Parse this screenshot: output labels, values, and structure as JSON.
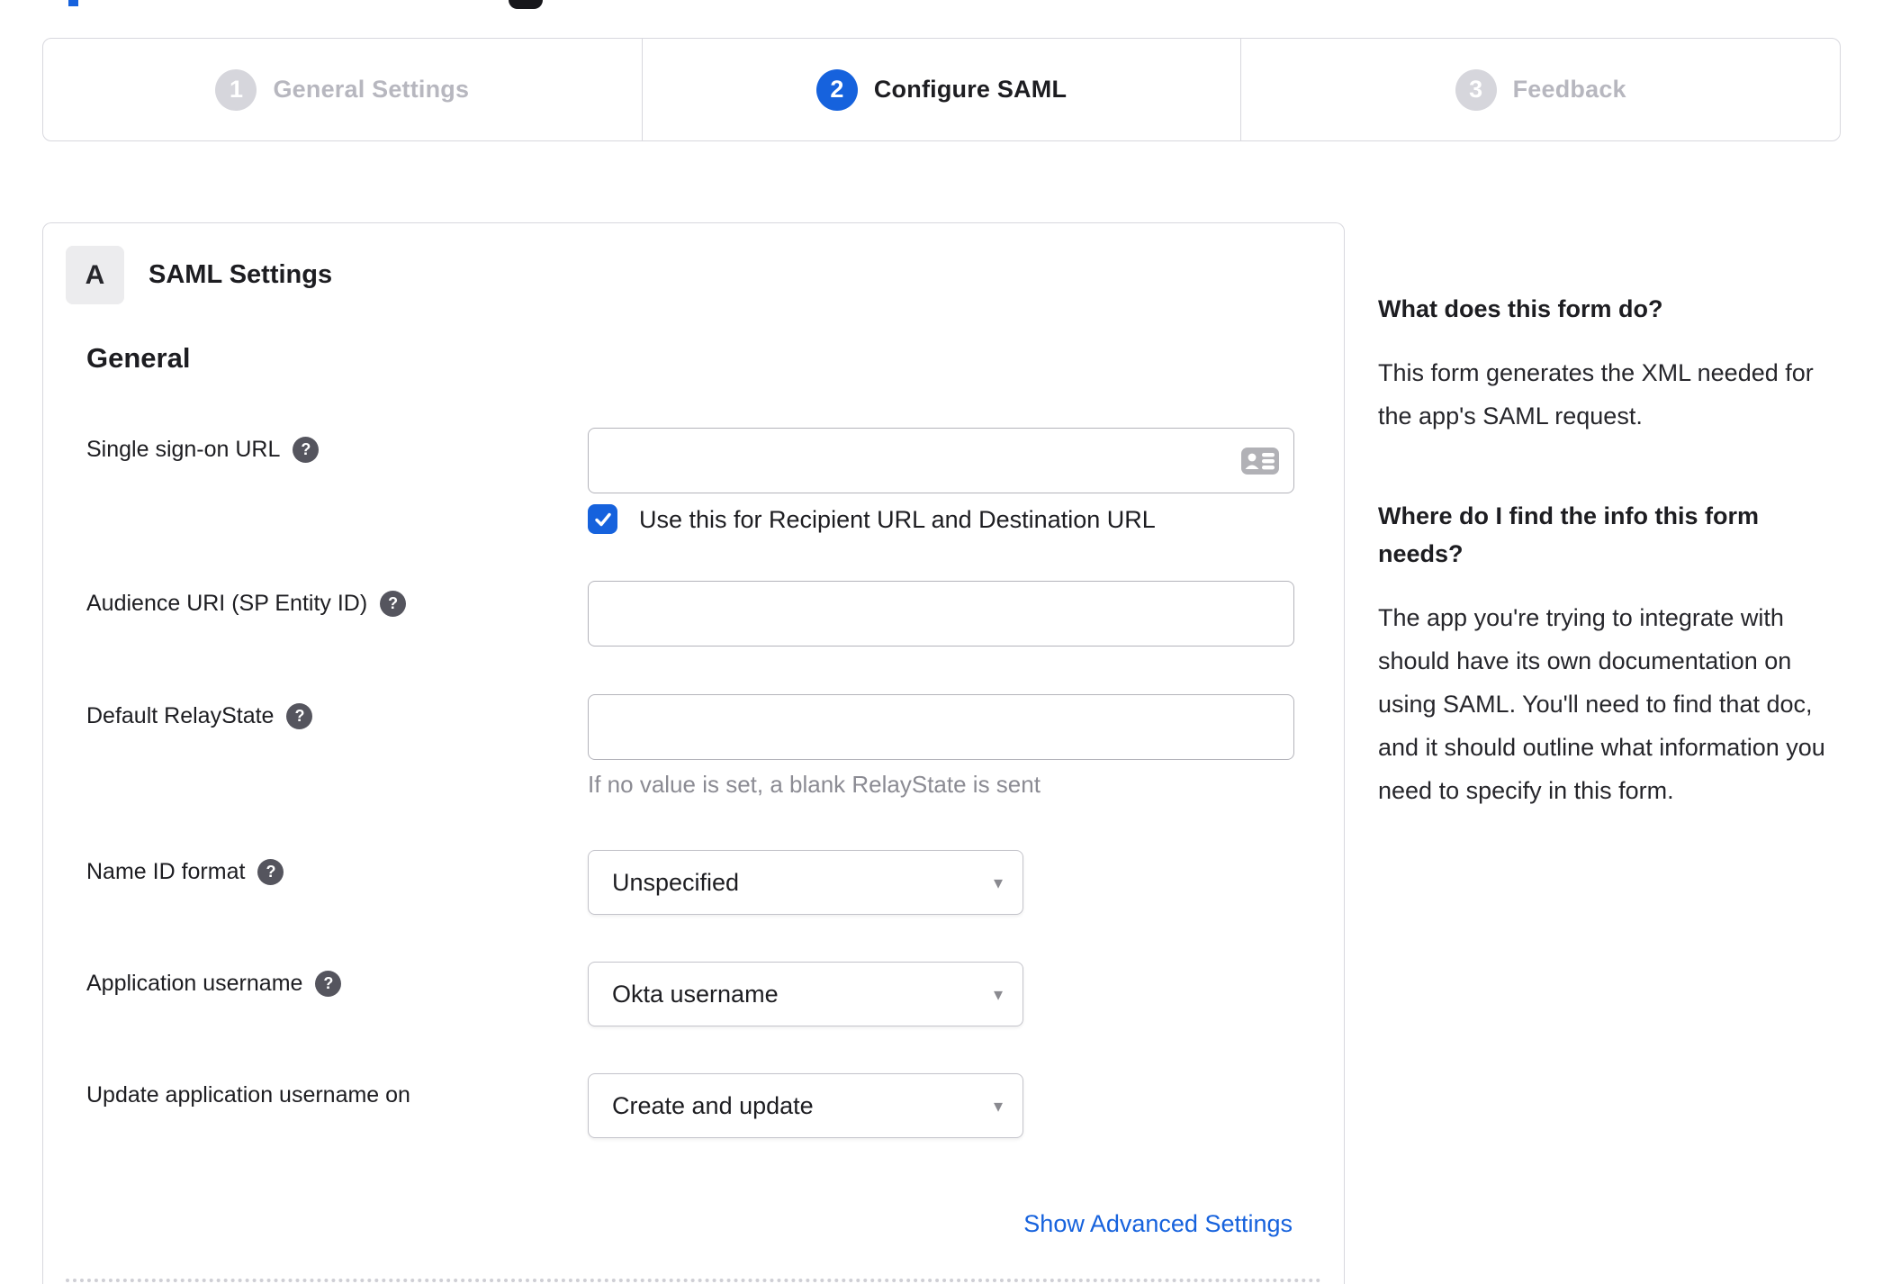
{
  "colors": {
    "accent": "#1662dd",
    "text": "#1d1d21",
    "muted_step": "#b7b7bf",
    "hint": "#8b8b93",
    "border": "#d8d8de",
    "help_icon_bg": "#55555e"
  },
  "stepper": {
    "steps": [
      {
        "number": "1",
        "label": "General Settings",
        "state": "inactive"
      },
      {
        "number": "2",
        "label": "Configure SAML",
        "state": "active"
      },
      {
        "number": "3",
        "label": "Feedback",
        "state": "inactive"
      }
    ]
  },
  "panel": {
    "badge": "A",
    "title": "SAML Settings",
    "section": "General",
    "fields": {
      "sso": {
        "label": "Single sign-on URL",
        "value": "",
        "checkbox_checked": true,
        "checkbox_label": "Use this for Recipient URL and Destination URL"
      },
      "audience": {
        "label": "Audience URI (SP Entity ID)",
        "value": ""
      },
      "relay": {
        "label": "Default RelayState",
        "value": "",
        "hint": "If no value is set, a blank RelayState is sent"
      },
      "nameid": {
        "label": "Name ID format",
        "value": "Unspecified"
      },
      "appuser": {
        "label": "Application username",
        "value": "Okta username"
      },
      "update": {
        "label": "Update application username on",
        "value": "Create and update"
      }
    },
    "advanced_link": "Show Advanced Settings"
  },
  "sidebar": {
    "q1": "What does this form do?",
    "a1": "This form generates the XML needed for the app's SAML request.",
    "q2": "Where do I find the info this form needs?",
    "a2": "The app you're trying to integrate with should have its own documentation on using SAML. You'll need to find that doc, and it should outline what information you need to specify in this form."
  },
  "icons": {
    "help_glyph": "?",
    "caret_glyph": "▾",
    "card_icon_name": "contact-card-icon",
    "check_icon_name": "checkmark-icon"
  }
}
